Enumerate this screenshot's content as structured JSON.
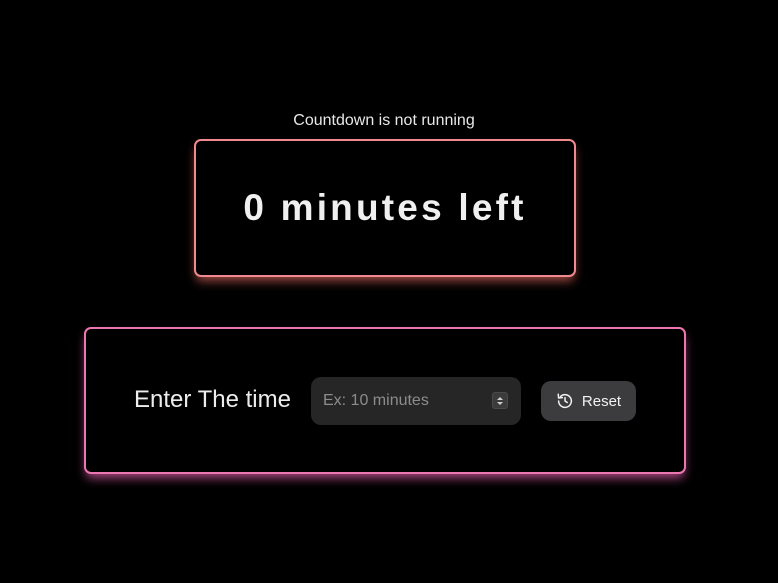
{
  "status": {
    "text": "Countdown is not running"
  },
  "display": {
    "time_left": "0 minutes left"
  },
  "controls": {
    "label": "Enter The time",
    "input": {
      "placeholder": "Ex: 10 minutes",
      "value": ""
    },
    "reset_button": {
      "label": "Reset",
      "icon": "history-reset-icon"
    }
  },
  "colors": {
    "background": "#000000",
    "display_border": "#f08a8e",
    "controls_border": "#ec77b0",
    "input_background": "#262626",
    "button_background": "#3c3c3f"
  }
}
